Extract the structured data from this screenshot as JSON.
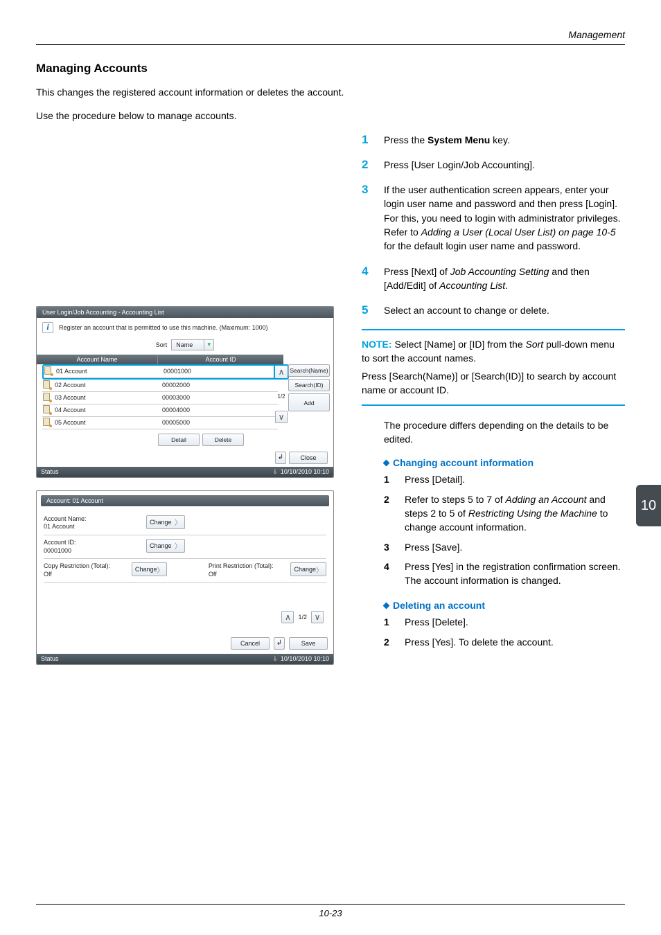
{
  "header": {
    "rightLabel": "Management"
  },
  "section": {
    "title": "Managing Accounts",
    "intro1": "This changes the registered account information or deletes the account.",
    "intro2": "Use the procedure below to manage accounts."
  },
  "steps": {
    "s1": {
      "n": "1",
      "a": "Press the ",
      "b": "System Menu",
      "c": " key."
    },
    "s2": {
      "n": "2",
      "t": "Press [User Login/Job Accounting]."
    },
    "s3": {
      "n": "3",
      "a": "If the user authentication screen appears, enter your login user name and password and then press [Login]. For this, you need to login with administrator privileges. Refer to ",
      "i": "Adding a User (Local User List) on page 10-5",
      "b": " for the default login user name and password."
    },
    "s4": {
      "n": "4",
      "a": "Press [Next] of ",
      "i1": "Job Accounting Setting",
      "b": " and then [Add/Edit] of ",
      "i2": "Accounting List",
      "c": "."
    },
    "s5": {
      "n": "5",
      "t": "Select an account to change or delete."
    }
  },
  "note": {
    "label": "NOTE:",
    "l1a": " Select [Name] or [ID] from the ",
    "l1i": "Sort",
    "l1b": " pull-down menu to sort the account names.",
    "l2": "Press [Search(Name)] or [Search(ID)] to search by account name or account ID."
  },
  "after": "The procedure differs depending on the details to be edited.",
  "tab": "10",
  "changing": {
    "title": "Changing account information",
    "s1": {
      "n": "1",
      "t": "Press [Detail]."
    },
    "s2": {
      "n": "2",
      "a": "Refer to steps 5 to 7 of ",
      "i1": "Adding an Account",
      "b": " and steps 2 to 5 of ",
      "i2": "Restricting Using the Machine",
      "c": " to change account information."
    },
    "s3": {
      "n": "3",
      "t": "Press [Save]."
    },
    "s4": {
      "n": "4",
      "t": "Press [Yes] in the registration confirmation screen. The account information is changed."
    }
  },
  "deleting": {
    "title": "Deleting an account",
    "s1": {
      "n": "1",
      "t": "Press [Delete]."
    },
    "s2": {
      "n": "2",
      "t": "Press [Yes]. To delete the account."
    }
  },
  "footer": {
    "page": "10-23"
  },
  "scr1": {
    "title": "User Login/Job Accounting - Accounting List",
    "info": "Register an account that is permitted to use this machine. (Maximum: 1000)",
    "sortLabel": "Sort",
    "sortValue": "Name",
    "col1": "Account Name",
    "col2": "Account ID",
    "rows": [
      {
        "name": "01  Account",
        "id": "00001000"
      },
      {
        "name": "02  Account",
        "id": "00002000"
      },
      {
        "name": "03  Account",
        "id": "00003000"
      },
      {
        "name": "04  Account",
        "id": "00004000"
      },
      {
        "name": "05  Account",
        "id": "00005000"
      }
    ],
    "searchName": "Search(Name)",
    "searchId": "Search(ID)",
    "add": "Add",
    "page": "1/2",
    "detail": "Detail",
    "delete": "Delete",
    "close": "Close",
    "status": "Status",
    "ts": "10/10/2010  10:10"
  },
  "scr2": {
    "title": "Account:    01 Account",
    "f1l": "Account Name:",
    "f1v": "01 Account",
    "f2l": "Account ID:",
    "f2v": "00001000",
    "f3l": "Copy Restriction (Total):",
    "f3v": "Off",
    "f4l": "Print Restriction (Total):",
    "f4v": "Off",
    "change": "Change",
    "page": "1/2",
    "cancel": "Cancel",
    "save": "Save",
    "status": "Status",
    "ts": "10/10/2010  10:10"
  }
}
